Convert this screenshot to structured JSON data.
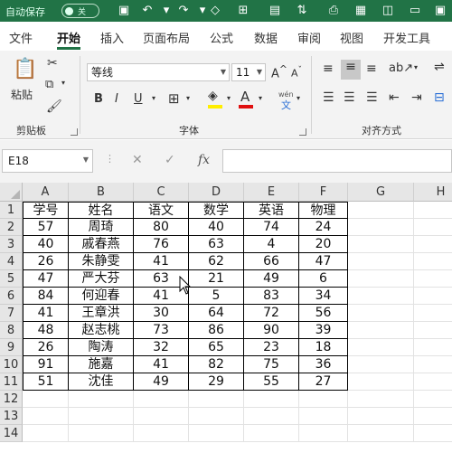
{
  "titlebar": {
    "autosave_label": "自动保存",
    "autosave_state": "关",
    "quick_icons": [
      "save-icon",
      "undo-icon",
      "redo-icon",
      "eraser-icon",
      "table-icon",
      "cell-format-icon",
      "sort-icon",
      "print-icon",
      "shapes-icon",
      "more-icon"
    ]
  },
  "tabs": [
    "文件",
    "开始",
    "插入",
    "页面布局",
    "公式",
    "数据",
    "审阅",
    "视图",
    "开发工具"
  ],
  "active_tab": "开始",
  "ribbon": {
    "clipboard": {
      "paste_label": "粘贴",
      "group_label": "剪贴板"
    },
    "font": {
      "font_name": "等线",
      "font_size": "11",
      "grow_label": "A",
      "shrink_label": "A",
      "bold": "B",
      "italic": "I",
      "underline": "U",
      "fill_label": "",
      "font_color_label": "A",
      "wen_label": "wén",
      "wen_char": "文",
      "group_label": "字体"
    },
    "alignment": {
      "group_label": "对齐方式"
    }
  },
  "formula_bar": {
    "name_box": "E18",
    "fx": "fx",
    "formula": ""
  },
  "sheet": {
    "columns": [
      "A",
      "B",
      "C",
      "D",
      "E",
      "F",
      "G",
      "H"
    ],
    "rows": [
      "1",
      "2",
      "3",
      "4",
      "5",
      "6",
      "7",
      "8",
      "9",
      "10",
      "11",
      "12",
      "13",
      "14"
    ],
    "table": [
      [
        "学号",
        "姓名",
        "语文",
        "数学",
        "英语",
        "物理"
      ],
      [
        "57",
        "周琦",
        "80",
        "40",
        "74",
        "24"
      ],
      [
        "40",
        "戚春燕",
        "76",
        "63",
        "4",
        "20"
      ],
      [
        "26",
        "朱静雯",
        "41",
        "62",
        "66",
        "47"
      ],
      [
        "47",
        "严大芬",
        "63",
        "21",
        "49",
        "6"
      ],
      [
        "84",
        "何迎春",
        "41",
        "5",
        "83",
        "34"
      ],
      [
        "41",
        "王章洪",
        "30",
        "64",
        "72",
        "56"
      ],
      [
        "48",
        "赵志桃",
        "73",
        "86",
        "90",
        "39"
      ],
      [
        "26",
        "陶涛",
        "32",
        "65",
        "23",
        "18"
      ],
      [
        "91",
        "施嘉",
        "41",
        "82",
        "75",
        "36"
      ],
      [
        "51",
        "沈佳",
        "49",
        "29",
        "55",
        "27"
      ]
    ]
  },
  "colors": {
    "accent": "#217346",
    "ribbon_bg": "#f3f3f3",
    "header_bg": "#e6e6e6"
  }
}
